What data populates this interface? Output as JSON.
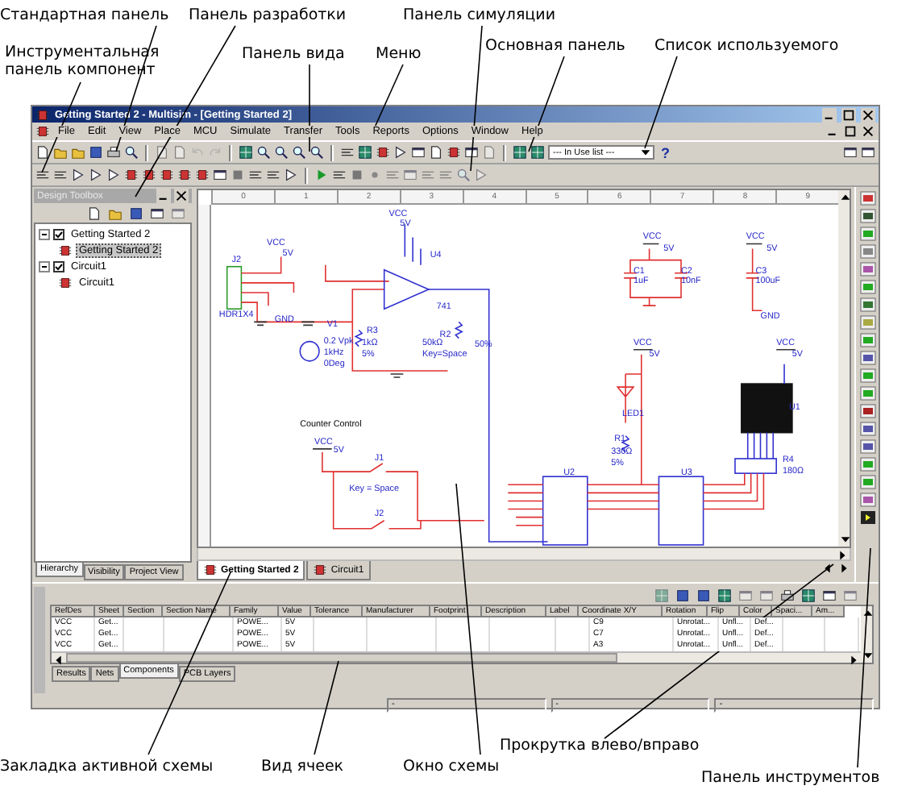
{
  "annotations": {
    "top": [
      {
        "text": "Стандартная панель"
      },
      {
        "text": "Панель разработки"
      },
      {
        "text": "Панель симуляции"
      },
      {
        "text": "Инструментальная панель компонент"
      },
      {
        "text": "Панель вида"
      },
      {
        "text": "Меню"
      },
      {
        "text": "Основная панель"
      },
      {
        "text": "Список используемого"
      }
    ],
    "bottom": [
      {
        "text": "Закладка активной схемы"
      },
      {
        "text": "Вид ячеек"
      },
      {
        "text": "Окно схемы"
      },
      {
        "text": "Прокрутка влево/вправо"
      },
      {
        "text": "Панель инструментов"
      }
    ]
  },
  "window": {
    "title": "Getting Started 2 - Multisim - [Getting Started 2]"
  },
  "menu": [
    "File",
    "Edit",
    "View",
    "Place",
    "MCU",
    "Simulate",
    "Transfer",
    "Tools",
    "Reports",
    "Options",
    "Window",
    "Help"
  ],
  "in_use_list": {
    "value": "--- In Use list ---"
  },
  "help_button": "?",
  "design_toolbox": {
    "title": "Design Toolbox",
    "tree": [
      {
        "label": "Getting Started 2",
        "checked": true,
        "expanded": true,
        "selected": false,
        "children": [
          {
            "label": "Getting Started 2",
            "selected": true
          }
        ]
      },
      {
        "label": "Circuit1",
        "checked": true,
        "expanded": true,
        "selected": false,
        "children": [
          {
            "label": "Circuit1",
            "selected": false
          }
        ]
      }
    ],
    "tabs": [
      {
        "label": "Hierarchy",
        "selected": true
      },
      {
        "label": "Visibility",
        "selected": false
      },
      {
        "label": "Project View",
        "selected": false
      }
    ]
  },
  "ruler": [
    "0",
    "1",
    "2",
    "3",
    "4",
    "5",
    "6",
    "7",
    "8",
    "9"
  ],
  "schematic": {
    "labels": [
      {
        "text": "VCC",
        "kind": "part"
      },
      {
        "text": "5V",
        "kind": "part"
      },
      {
        "text": "J2",
        "kind": "part"
      },
      {
        "text": "HDR1X4",
        "kind": "part"
      },
      {
        "text": "GND",
        "kind": "part"
      },
      {
        "text": "VCC",
        "kind": "part"
      },
      {
        "text": "5V",
        "kind": "part"
      },
      {
        "text": "U4",
        "kind": "part"
      },
      {
        "text": "V1",
        "kind": "part"
      },
      {
        "text": "0.2 Vpk",
        "kind": "part"
      },
      {
        "text": "1kHz",
        "kind": "part"
      },
      {
        "text": "0Deg",
        "kind": "part"
      },
      {
        "text": "R3",
        "kind": "part"
      },
      {
        "text": "1kΩ",
        "kind": "part"
      },
      {
        "text": "5%",
        "kind": "part"
      },
      {
        "text": "741",
        "kind": "part"
      },
      {
        "text": "R2",
        "kind": "part"
      },
      {
        "text": "50kΩ",
        "kind": "part"
      },
      {
        "text": "Key=Space",
        "kind": "part"
      },
      {
        "text": "50%",
        "kind": "part"
      },
      {
        "text": "VCC",
        "kind": "part"
      },
      {
        "text": "5V",
        "kind": "part"
      },
      {
        "text": "C1",
        "kind": "part"
      },
      {
        "text": "1uF",
        "kind": "part"
      },
      {
        "text": "C2",
        "kind": "part"
      },
      {
        "text": "10nF",
        "kind": "part"
      },
      {
        "text": "VCC",
        "kind": "part"
      },
      {
        "text": "5V",
        "kind": "part"
      },
      {
        "text": "C3",
        "kind": "part"
      },
      {
        "text": "100uF",
        "kind": "part"
      },
      {
        "text": "GND",
        "kind": "part"
      },
      {
        "text": "VCC",
        "kind": "part"
      },
      {
        "text": "5V",
        "kind": "part"
      },
      {
        "text": "VCC",
        "kind": "part"
      },
      {
        "text": "5V",
        "kind": "part"
      },
      {
        "text": "LED1",
        "kind": "part"
      },
      {
        "text": "R1",
        "kind": "part"
      },
      {
        "text": "330Ω",
        "kind": "part"
      },
      {
        "text": "5%",
        "kind": "part"
      },
      {
        "text": "U1",
        "kind": "part"
      },
      {
        "text": "U2",
        "kind": "part"
      },
      {
        "text": "U3",
        "kind": "part"
      },
      {
        "text": "R4",
        "kind": "part"
      },
      {
        "text": "180Ω",
        "kind": "part"
      },
      {
        "text": "Counter Control",
        "kind": "note"
      },
      {
        "text": "VCC",
        "kind": "part"
      },
      {
        "text": "5V",
        "kind": "part"
      },
      {
        "text": "J1",
        "kind": "part"
      },
      {
        "text": "Key = Space",
        "kind": "part"
      },
      {
        "text": "J2",
        "kind": "part"
      }
    ]
  },
  "sheet_tabs": [
    {
      "label": "Getting Started 2",
      "selected": true
    },
    {
      "label": "Circuit1",
      "selected": false
    }
  ],
  "spreadsheet": {
    "columns": [
      "RefDes",
      "Sheet",
      "Section",
      "Section Name",
      "Family",
      "Value",
      "Tolerance",
      "Manufacturer",
      "Footprint",
      "Description",
      "Label",
      "Coordinate X/Y",
      "Rotation",
      "Flip",
      "Color",
      "Spaci...",
      "Am..."
    ],
    "rows": [
      [
        "VCC",
        "Get...",
        null,
        null,
        "POWE...",
        "5V",
        null,
        null,
        null,
        null,
        null,
        "C9",
        "Unrotat...",
        "Unfl...",
        "Def...",
        null,
        null
      ],
      [
        "VCC",
        "Get...",
        null,
        null,
        "POWE...",
        "5V",
        null,
        null,
        null,
        null,
        null,
        "C7",
        "Unrotat...",
        "Unfl...",
        "Def...",
        null,
        null
      ],
      [
        "VCC",
        "Get...",
        null,
        null,
        "POWE...",
        "5V",
        null,
        null,
        null,
        null,
        null,
        "A3",
        "Unrotat...",
        "Unfl...",
        "Def...",
        null,
        null
      ]
    ],
    "tabs": [
      {
        "label": "Results",
        "selected": false
      },
      {
        "label": "Nets",
        "selected": false
      },
      {
        "label": "Components",
        "selected": true
      },
      {
        "label": "PCB Layers",
        "selected": false
      }
    ]
  },
  "status_bar": [
    "-",
    "-",
    "-"
  ]
}
